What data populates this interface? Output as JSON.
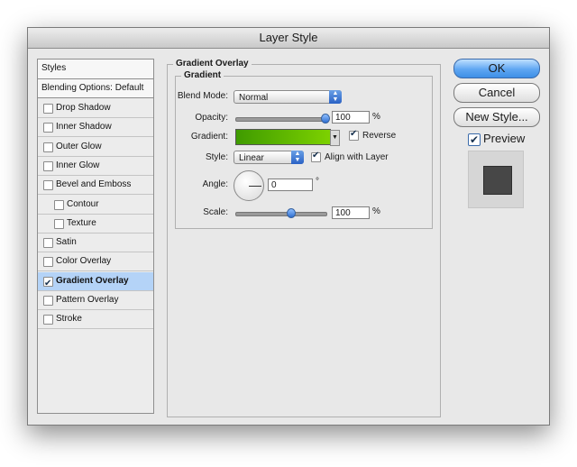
{
  "window": {
    "title": "Layer Style"
  },
  "sidebar": {
    "items": [
      {
        "label": "Styles",
        "has_checkbox": false,
        "checked": false,
        "indent": false,
        "selected": false
      },
      {
        "label": "Blending Options: Default",
        "has_checkbox": false,
        "checked": false,
        "indent": false,
        "selected": false
      },
      {
        "label": "Drop Shadow",
        "has_checkbox": true,
        "checked": false,
        "indent": false,
        "selected": false
      },
      {
        "label": "Inner Shadow",
        "has_checkbox": true,
        "checked": false,
        "indent": false,
        "selected": false
      },
      {
        "label": "Outer Glow",
        "has_checkbox": true,
        "checked": false,
        "indent": false,
        "selected": false
      },
      {
        "label": "Inner Glow",
        "has_checkbox": true,
        "checked": false,
        "indent": false,
        "selected": false
      },
      {
        "label": "Bevel and Emboss",
        "has_checkbox": true,
        "checked": false,
        "indent": false,
        "selected": false
      },
      {
        "label": "Contour",
        "has_checkbox": true,
        "checked": false,
        "indent": true,
        "selected": false
      },
      {
        "label": "Texture",
        "has_checkbox": true,
        "checked": false,
        "indent": true,
        "selected": false
      },
      {
        "label": "Satin",
        "has_checkbox": true,
        "checked": false,
        "indent": false,
        "selected": false
      },
      {
        "label": "Color Overlay",
        "has_checkbox": true,
        "checked": false,
        "indent": false,
        "selected": false
      },
      {
        "label": "Gradient Overlay",
        "has_checkbox": true,
        "checked": true,
        "indent": false,
        "selected": true
      },
      {
        "label": "Pattern Overlay",
        "has_checkbox": true,
        "checked": false,
        "indent": false,
        "selected": false
      },
      {
        "label": "Stroke",
        "has_checkbox": true,
        "checked": false,
        "indent": false,
        "selected": false
      }
    ]
  },
  "panel": {
    "group_title": "Gradient Overlay",
    "subgroup_title": "Gradient",
    "blend_mode": {
      "label": "Blend Mode:",
      "value": "Normal"
    },
    "opacity": {
      "label": "Opacity:",
      "value": "100",
      "unit": "%",
      "level": 1.0
    },
    "gradient": {
      "label": "Gradient:",
      "start_color": "#3f9b00",
      "end_color": "#7dd100"
    },
    "reverse": {
      "label": "Reverse",
      "checked": true
    },
    "style": {
      "label": "Style:",
      "value": "Linear"
    },
    "align": {
      "label": "Align with Layer",
      "checked": true
    },
    "angle": {
      "label": "Angle:",
      "value": "0",
      "unit": "°"
    },
    "scale": {
      "label": "Scale:",
      "value": "100",
      "unit": "%",
      "level": 0.62
    }
  },
  "buttons": {
    "ok": "OK",
    "cancel": "Cancel",
    "new_style": "New Style..."
  },
  "preview": {
    "label": "Preview",
    "checked": true,
    "swatch_color": "#474747"
  },
  "colors": {
    "selection": "#b4d3f7",
    "accent": "#3e8fe6"
  }
}
